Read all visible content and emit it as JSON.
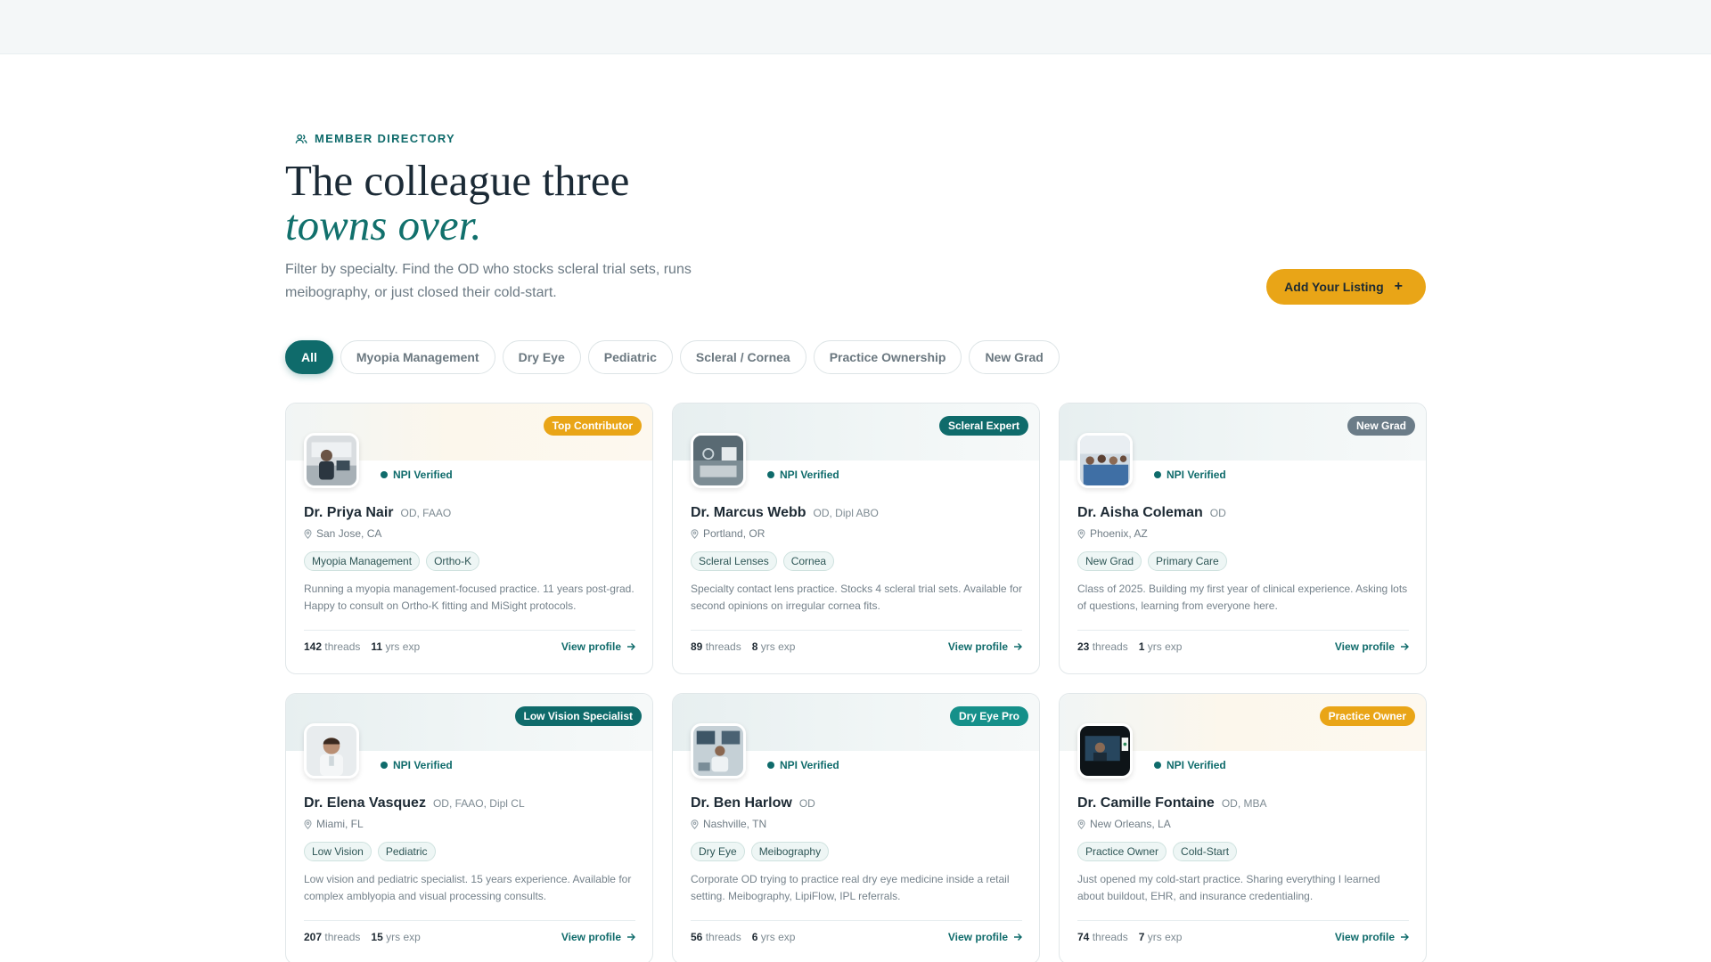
{
  "header": {
    "eyebrow": "MEMBER DIRECTORY",
    "headline_line1": "The colleague three",
    "headline_line2": "towns over.",
    "subtitle": "Filter by specialty. Find the OD who stocks scleral trial sets, runs meibography, or just closed their cold-start.",
    "add_listing_label": "Add Your Listing",
    "add_listing_icon": "+"
  },
  "filters": [
    {
      "label": "All",
      "active": true
    },
    {
      "label": "Myopia Management",
      "active": false
    },
    {
      "label": "Dry Eye",
      "active": false
    },
    {
      "label": "Pediatric",
      "active": false
    },
    {
      "label": "Scleral / Cornea",
      "active": false
    },
    {
      "label": "Practice Ownership",
      "active": false
    },
    {
      "label": "New Grad",
      "active": false
    }
  ],
  "colors": {
    "brand_teal": "#0f6b6b",
    "accent_gold": "#e9a517",
    "badge_slate": "#6b7c88",
    "badge_teal_light": "#15908a"
  },
  "card_common": {
    "verified_label": "NPI Verified",
    "threads_label": "threads",
    "yrs_label": "yrs exp",
    "view_profile_label": "View profile"
  },
  "members": [
    {
      "badge": "Top Contributor",
      "badge_color": "#e9a517",
      "name": "Dr. Priya Nair",
      "creds": "OD, FAAO",
      "location": "San Jose, CA",
      "tags": [
        "Myopia Management",
        "Ortho-K"
      ],
      "desc": "Running a myopia management-focused practice. 11 years post-grad. Happy to consult on Ortho-K fitting and MiSight protocols.",
      "threads": "142",
      "yrs": "11"
    },
    {
      "badge": "Scleral Expert",
      "badge_color": "#0f6b6b",
      "name": "Dr. Marcus Webb",
      "creds": "OD, Dipl ABO",
      "location": "Portland, OR",
      "tags": [
        "Scleral Lenses",
        "Cornea"
      ],
      "desc": "Specialty contact lens practice. Stocks 4 scleral trial sets. Available for second opinions on irregular cornea fits.",
      "threads": "89",
      "yrs": "8"
    },
    {
      "badge": "New Grad",
      "badge_color": "#6b7c88",
      "name": "Dr. Aisha Coleman",
      "creds": "OD",
      "location": "Phoenix, AZ",
      "tags": [
        "New Grad",
        "Primary Care"
      ],
      "desc": "Class of 2025. Building my first year of clinical experience. Asking lots of questions, learning from everyone here.",
      "threads": "23",
      "yrs": "1"
    },
    {
      "badge": "Low Vision Specialist",
      "badge_color": "#0f6b6b",
      "name": "Dr. Elena Vasquez",
      "creds": "OD, FAAO, Dipl CL",
      "location": "Miami, FL",
      "tags": [
        "Low Vision",
        "Pediatric"
      ],
      "desc": "Low vision and pediatric specialist. 15 years experience. Available for complex amblyopia and visual processing consults.",
      "threads": "207",
      "yrs": "15"
    },
    {
      "badge": "Dry Eye Pro",
      "badge_color": "#15908a",
      "name": "Dr. Ben Harlow",
      "creds": "OD",
      "location": "Nashville, TN",
      "tags": [
        "Dry Eye",
        "Meibography"
      ],
      "desc": "Corporate OD trying to practice real dry eye medicine inside a retail setting. Meibography, LipiFlow, IPL referrals.",
      "threads": "56",
      "yrs": "6"
    },
    {
      "badge": "Practice Owner",
      "badge_color": "#e9a517",
      "name": "Dr. Camille Fontaine",
      "creds": "OD, MBA",
      "location": "New Orleans, LA",
      "tags": [
        "Practice Owner",
        "Cold-Start"
      ],
      "desc": "Just opened my cold-start practice. Sharing everything I learned about buildout, EHR, and insurance credentialing.",
      "threads": "74",
      "yrs": "7"
    }
  ]
}
